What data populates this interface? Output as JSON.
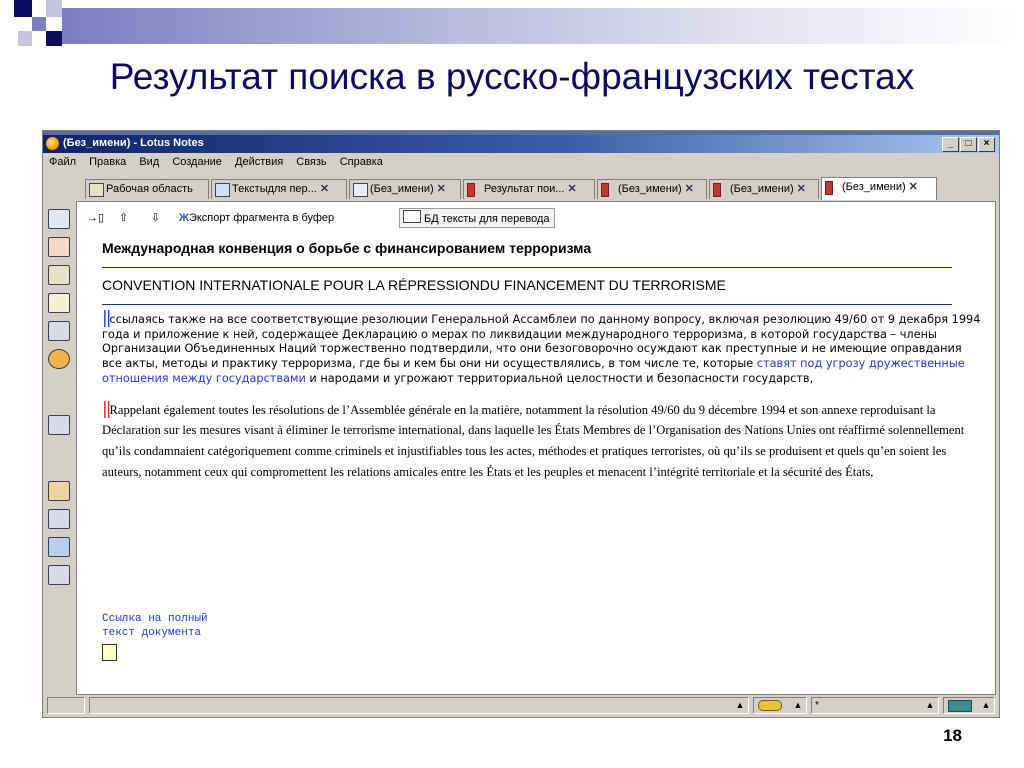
{
  "slide": {
    "title": "Результат поиска в русско-французских тестах",
    "page_number": "18"
  },
  "window": {
    "title": "(Без_имени) - Lotus Notes",
    "buttons": {
      "minimize": "_",
      "maximize": "□",
      "close": "×"
    }
  },
  "menu": [
    "Файл",
    "Правка",
    "Вид",
    "Создание",
    "Действия",
    "Связь",
    "Справка"
  ],
  "tabs": [
    {
      "label": "Рабочая область",
      "icon": "workspace-icon",
      "close": ""
    },
    {
      "label": "Текстыдля пер...",
      "icon": "view-icon",
      "close": "✕"
    },
    {
      "label": "(Без_имени)",
      "icon": "document-icon",
      "close": "✕"
    },
    {
      "label": "Результат пои...",
      "icon": "books-icon",
      "close": "✕"
    },
    {
      "label": "(Без_имени)",
      "icon": "books-document-icon",
      "close": "✕"
    },
    {
      "label": "(Без_имени)",
      "icon": "books-document-icon",
      "close": "✕"
    },
    {
      "label": "(Без_имени)",
      "icon": "books-document-icon",
      "close": "✕"
    }
  ],
  "toolbar": {
    "export_label": "Экспорт фрагмента в буфер",
    "db_label": "БД тексты для перевода",
    "up_glyph": "⇧",
    "down_glyph": "⇩"
  },
  "document": {
    "title_ru": "Международная конвенция о борьбе с финансированием терроризма",
    "title_fr": "CONVENTION INTERNATIONALE POUR LA RÉPRESSIONDU FINANCEMENT DU TERRORISME",
    "marker": "||",
    "para_ru_before": "ссылаясь также на все соответствующие резолюции Генеральной Ассамблеи по данному вопросу, включая резолюцию 49/60 от 9 декабря 1994 года и приложение к ней, содержащее Декларацию о мерах по ликвидации международного терроризма, в которой государства – члены Организации Объединенных Наций торжественно подтвердили, что они безоговорочно осуждают как преступные и не имеющие оправдания все акты, методы и практику терроризма, где бы и кем бы они ни осуществлялись, в том числе те, которые ",
    "para_ru_highlight": "ставят под угрозу дружественные отношения между государствами",
    "para_ru_after": " и народами и угрожают территориальной целостности и безопасности государств,",
    "para_fr": "Rappelant également toutes les résolutions de l’Assemblée générale en la matière, notamment la résolution 49/60 du 9 décembre 1994 et son annexe reproduisant la Déclaration sur les mesures visant à éliminer le terrorisme international, dans laquelle les États Membres de l’Organisation des Nations Unies ont réaffirmé solennellement qu’ils condamnaient catégoriquement comme criminels et injustifiables tous les actes, méthodes et pratiques terroristes, où qu’ils se produisent et quels qu’en soient les auteurs, notamment ceux qui compromettent les relations amicales entre les États et les peuples et  menacent l’intégrité territoriale et la sécurité des États,",
    "link_line1": "Ссылка на полный",
    "link_line2": "текст документа"
  },
  "statusbar": {
    "field_text": "*"
  },
  "colors": {
    "slide_title": "#0b0b60",
    "titlebar": "#0a246a",
    "highlight": "#1a3bd8",
    "marker_red": "#e02020"
  }
}
